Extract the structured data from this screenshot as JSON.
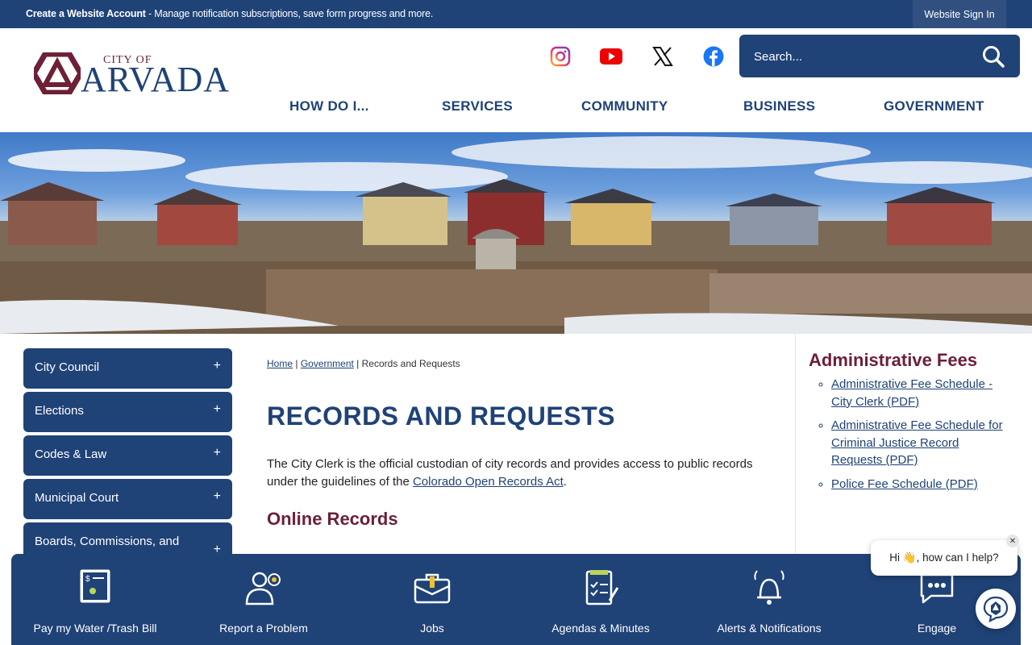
{
  "topbar": {
    "create_label": "Create a Website Account",
    "create_desc": " - Manage notification subscriptions, save form progress and more.",
    "signin_label": "Website Sign In"
  },
  "logo": {
    "city_of": "CITY OF",
    "name": "ARVADA"
  },
  "social": [
    "instagram-icon",
    "youtube-icon",
    "x-icon",
    "facebook-icon"
  ],
  "search": {
    "placeholder": "Search..."
  },
  "main_nav": [
    "HOW DO I...",
    "SERVICES",
    "COMMUNITY",
    "BUSINESS",
    "GOVERNMENT"
  ],
  "side_nav": [
    {
      "label": "City Council",
      "toggle": "+"
    },
    {
      "label": "Elections",
      "toggle": "+"
    },
    {
      "label": "Codes & Law",
      "toggle": "+"
    },
    {
      "label": "Municipal Court",
      "toggle": "+"
    },
    {
      "label": "Boards, Commissions, and",
      "toggle": "+"
    }
  ],
  "breadcrumb": {
    "home": "Home",
    "sep": " | ",
    "government": "Government",
    "current": "Records and Requests"
  },
  "page_title": "RECORDS AND REQUESTS",
  "intro": {
    "text": "The City Clerk is the official custodian of city records and provides access to public records under the guidelines of the ",
    "link": "Colorado Open Records Act",
    "end": "."
  },
  "section_title": "Online Records",
  "admin_fees": {
    "title": "Administrative Fees",
    "links": [
      "Administrative Fee Schedule - City Clerk (PDF)",
      "Administrative Fee Schedule for Criminal Justice Record Requests (PDF)",
      "Police Fee Schedule (PDF)"
    ]
  },
  "quick_links": [
    {
      "label": "Pay my Water /Trash Bill",
      "icon": "bill-icon"
    },
    {
      "label": "Report a Problem",
      "icon": "report-person-icon"
    },
    {
      "label": "Jobs",
      "icon": "briefcase-icon"
    },
    {
      "label": "Agendas & Minutes",
      "icon": "agenda-icon"
    },
    {
      "label": "Alerts & Notifications",
      "icon": "bell-icon"
    },
    {
      "label": "Engage",
      "icon": "chat-icon"
    }
  ],
  "chat": {
    "greeting": "Hi 👋, how can I help?",
    "close": "✕"
  },
  "colors": {
    "primary": "#1f4277",
    "accent": "#6d2036"
  }
}
